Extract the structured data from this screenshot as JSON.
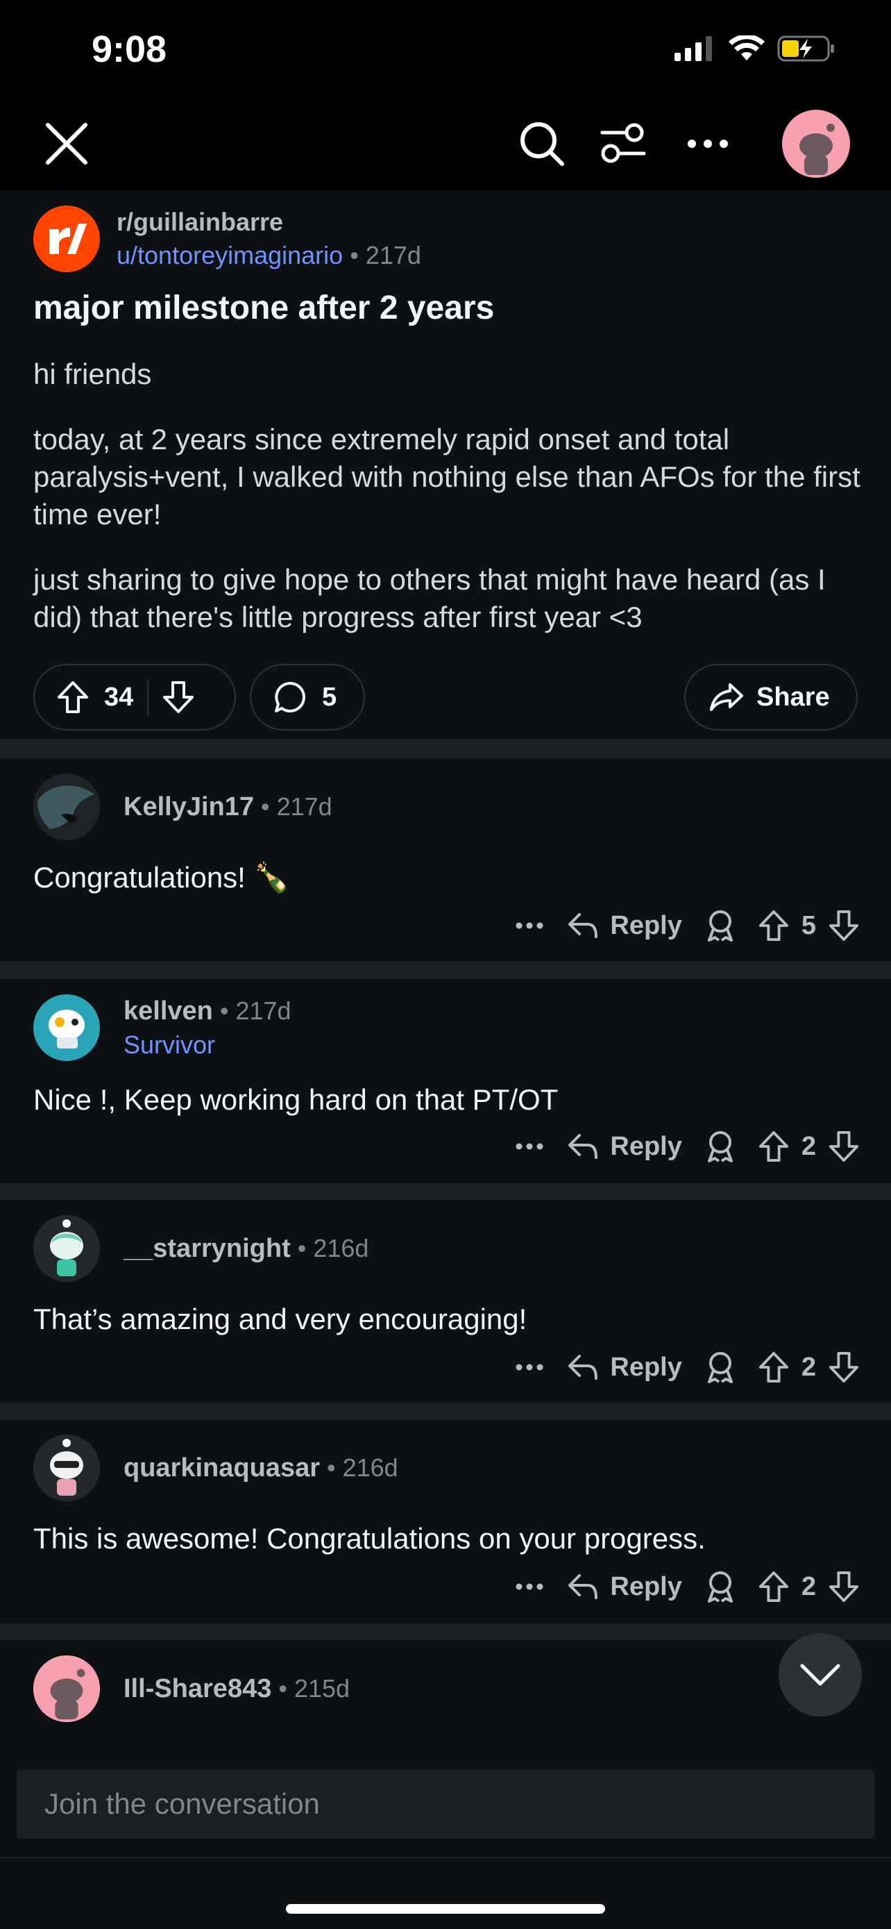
{
  "status": {
    "time": "9:08"
  },
  "nav": {
    "close_icon": "close-icon",
    "search_icon": "search-icon",
    "filter_icon": "sort-icon",
    "more_icon": "more-icon"
  },
  "post": {
    "subreddit": "r/guillainbarre",
    "author": "u/tontoreyimaginario",
    "age": "217d",
    "title": "major milestone after 2 years",
    "body": [
      "hi friends",
      "today, at 2 years since extremely rapid onset and total paralysis+vent, I walked with nothing else than AFOs for the first time ever!",
      "just sharing to give hope to others that might have heard (as I did) that there's little progress after first year <3"
    ],
    "votes": "34",
    "comments": "5",
    "share_label": "Share"
  },
  "comments": [
    {
      "author": "KellyJin17",
      "age": "217d",
      "flair": "",
      "text": "Congratulations! 🍾",
      "votes": "5",
      "reply_label": "Reply"
    },
    {
      "author": "kellven",
      "age": "217d",
      "flair": "Survivor",
      "text": "Nice !, Keep working hard on that PT/OT",
      "votes": "2",
      "reply_label": "Reply"
    },
    {
      "author": "__starrynight",
      "age": "216d",
      "flair": "",
      "text": "That’s amazing and very encouraging!",
      "votes": "2",
      "reply_label": "Reply"
    },
    {
      "author": "quarkinaquasar",
      "age": "216d",
      "flair": "",
      "text": "This is awesome! Congratulations on your progress.",
      "votes": "2",
      "reply_label": "Reply"
    },
    {
      "author": "Ill-Share843",
      "age": "215d",
      "flair": "",
      "text": "",
      "votes": "",
      "reply_label": ""
    }
  ],
  "composer": {
    "placeholder": "Join the conversation"
  },
  "colors": {
    "accent": "#ff4500",
    "link": "#7193ff",
    "background": "#0e1113"
  }
}
